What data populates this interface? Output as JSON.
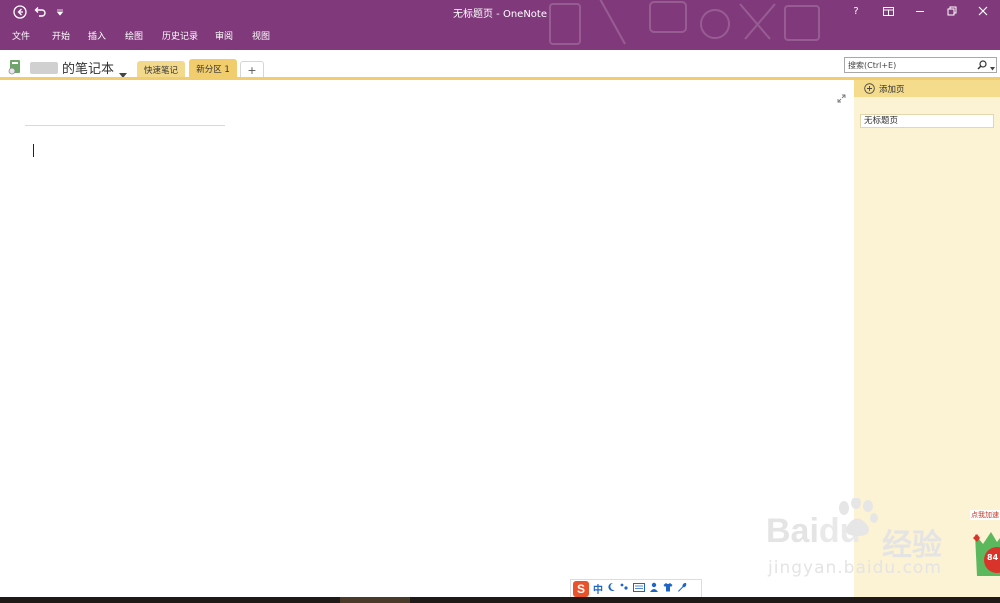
{
  "window": {
    "title": "无标题页 - OneNote",
    "controls": {
      "help": "?",
      "ribbon_display": "ribbon-display-icon",
      "minimize": "minimize-icon",
      "restore": "restore-icon",
      "close": "close-icon"
    }
  },
  "quick_access": {
    "back": "back-icon",
    "undo": "undo-icon",
    "customize": "customize-icon"
  },
  "menu": [
    "文件",
    "开始",
    "插入",
    "绘图",
    "历史记录",
    "审阅",
    "视图"
  ],
  "notebook": {
    "name": "的笔记本",
    "dropdown": "chevron-down-icon"
  },
  "sections": [
    {
      "label": "快速笔记",
      "color": "#f3d98c"
    },
    {
      "label": "新分区 1",
      "color": "#f1cd6e"
    }
  ],
  "add_section": "+",
  "search": {
    "placeholder": "搜索(Ctrl+E)"
  },
  "pages_panel": {
    "add_page": "添加页",
    "pages": [
      "无标题页"
    ]
  },
  "ime": {
    "mode": "中"
  },
  "watermark": {
    "brand": "Bai",
    "brand2": "du",
    "text": "经验",
    "url": "jingyan.baidu.com"
  },
  "badge": {
    "label": "点我加速",
    "value": "84"
  },
  "colors": {
    "accent": "#80397b",
    "section_yellow": "#f1cd6e",
    "pane_bg": "#fcf2d4"
  }
}
